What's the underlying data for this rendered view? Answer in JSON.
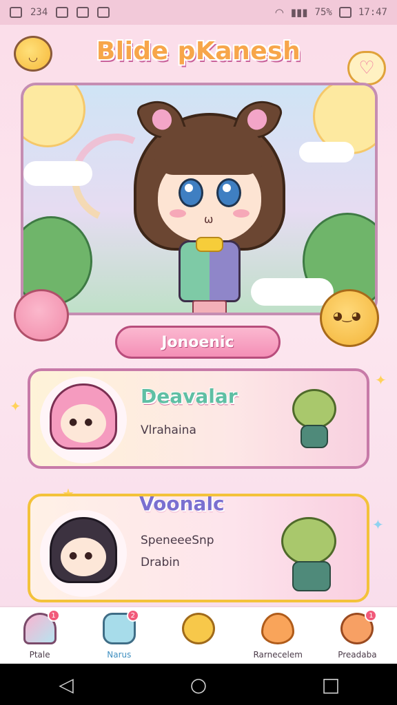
{
  "status_bar": {
    "left_text": "234",
    "time": "17:47",
    "battery": "75%"
  },
  "header": {
    "title": "Blide pKanesh"
  },
  "hero": {
    "character_name": "Jonoenic"
  },
  "cards": [
    {
      "title": "Deavalar",
      "subtitles": [
        "Vlrahaina"
      ]
    },
    {
      "title": "Voonalc",
      "subtitles": [
        "SpeneeeSnp",
        "Drabin"
      ]
    }
  ],
  "bottom_nav": {
    "items": [
      {
        "label": "Ptale",
        "icon": "home-icon",
        "badge": "1"
      },
      {
        "label": "Narus",
        "icon": "menu-icon",
        "badge": "2"
      },
      {
        "label": "",
        "icon": "pet-icon",
        "badge": ""
      },
      {
        "label": "Rarnecelem",
        "icon": "heart-icon",
        "badge": ""
      },
      {
        "label": "Preadaba",
        "icon": "face-icon",
        "badge": "1"
      }
    ]
  },
  "colors": {
    "accent_pink": "#f48fb6",
    "accent_gold": "#f3c23a",
    "background": "#fbdde9"
  }
}
